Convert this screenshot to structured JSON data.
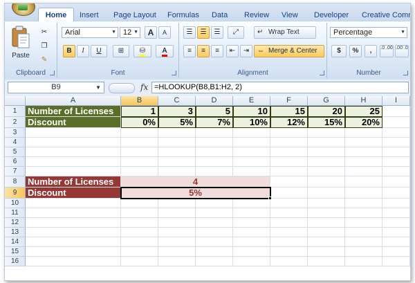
{
  "tabs": [
    "Home",
    "Insert",
    "Page Layout",
    "Formulas",
    "Data",
    "Review",
    "View",
    "Developer",
    "Creative Commons"
  ],
  "active_tab": "Home",
  "ribbon": {
    "clipboard": {
      "paste_label": "Paste",
      "group_label": "Clipboard"
    },
    "font": {
      "name": "Arial",
      "size": "12",
      "bold": "B",
      "italic": "I",
      "underline": "U",
      "grow": "A",
      "shrink": "A",
      "font_color": "A",
      "group_label": "Font"
    },
    "alignment": {
      "wrap_text": "Wrap Text",
      "merge_center": "Merge & Center",
      "group_label": "Alignment"
    },
    "number": {
      "format": "Percentage",
      "currency": "$",
      "percent": "%",
      "comma": ",",
      "inc_decimal": ".0 .00",
      "dec_decimal": ".00 .0",
      "group_label": "Number"
    }
  },
  "formula_bar": {
    "name_box": "B9",
    "fx": "fx",
    "formula": "=HLOOKUP(B8,B1:H2, 2)"
  },
  "columns": [
    "A",
    "B",
    "C",
    "D",
    "E",
    "F",
    "G",
    "H",
    "I"
  ],
  "rows": [
    "1",
    "2",
    "3",
    "4",
    "5",
    "6",
    "7",
    "8",
    "9",
    "10",
    "11",
    "12",
    "13",
    "14",
    "15",
    "16"
  ],
  "table": {
    "row1_label": "Number of Licenses",
    "row1_values": [
      "1",
      "3",
      "5",
      "10",
      "15",
      "20",
      "25"
    ],
    "row2_label": "Discount",
    "row2_values": [
      "0%",
      "5%",
      "7%",
      "10%",
      "12%",
      "15%",
      "20%"
    ]
  },
  "lookup": {
    "licenses_label": "Number of Licenses",
    "licenses_value": "4",
    "discount_label": "Discount",
    "discount_value": "5%"
  },
  "colors": {
    "green_label": "#5b6e27",
    "green_fill": "#ebf1dc",
    "red_label": "#953734",
    "red_fill": "#f2dcdb",
    "header_selected": "#f7c55e"
  },
  "selected_cell": "B9"
}
